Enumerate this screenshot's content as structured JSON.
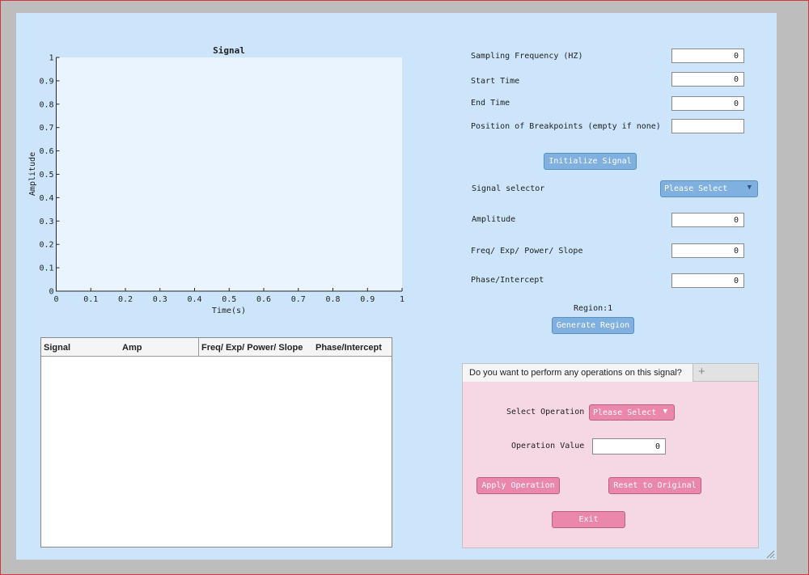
{
  "chart": {
    "title": "Signal",
    "xlabel": "Time(s)",
    "ylabel": "Amplitude"
  },
  "chart_data": {
    "type": "line",
    "title": "Signal",
    "xlabel": "Time(s)",
    "ylabel": "Amplitude",
    "xlim": [
      0,
      1
    ],
    "ylim": [
      0,
      1
    ],
    "xticks": [
      "0",
      "0.1",
      "0.2",
      "0.3",
      "0.4",
      "0.5",
      "0.6",
      "0.7",
      "0.8",
      "0.9",
      "1"
    ],
    "yticks": [
      "0",
      "0.1",
      "0.2",
      "0.3",
      "0.4",
      "0.5",
      "0.6",
      "0.7",
      "0.8",
      "0.9",
      "1"
    ],
    "series": [],
    "grid": false
  },
  "table": {
    "headers": [
      "Signal",
      "Amp",
      "Freq/ Exp/ Power/ Slope",
      "Phase/Intercept"
    ],
    "rows": []
  },
  "form": {
    "sampling_frequency_label": "Sampling Frequency (HZ)",
    "sampling_frequency_value": "0",
    "start_time_label": "Start Time",
    "start_time_value": "0",
    "end_time_label": "End Time",
    "end_time_value": "0",
    "breakpoints_label": "Position of Breakpoints (empty if none)",
    "breakpoints_value": "",
    "initialize_button": "Initialize Signal",
    "signal_selector_label": "Signal selector",
    "signal_selector_value": "Please Select",
    "amplitude_label": "Amplitude",
    "amplitude_value": "0",
    "freq_label": "Freq/ Exp/ Power/ Slope",
    "freq_value": "0",
    "phase_label": "Phase/Intercept",
    "phase_value": "0",
    "region_text": "Region:1",
    "generate_button": "Generate Region"
  },
  "operations": {
    "tab_label": "Do you want to perform any operations on this signal?",
    "tab_plus": "+",
    "select_label": "Select Operation",
    "select_value": "Please Select",
    "value_label": "Operation Value",
    "value_value": "0",
    "apply_button": "Apply Operation",
    "reset_button": "Reset to Original",
    "exit_button": "Exit"
  },
  "colors": {
    "panel_bg": "#cce5fb",
    "axes_bg": "#eaf4fe",
    "button_blue": "#7fb0e0",
    "button_pink": "#ea87aa",
    "ops_bg": "#f6d8e4"
  }
}
